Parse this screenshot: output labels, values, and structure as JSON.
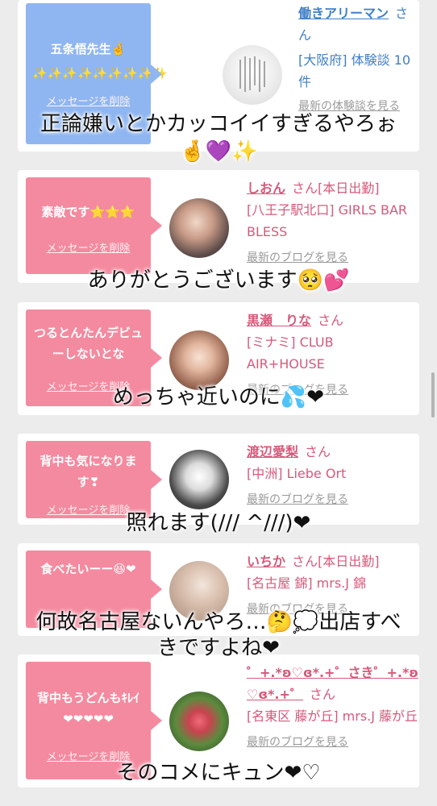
{
  "cards": [
    {
      "message": "五条悟先生🤞\n✨✨✨✨✨✨✨✨✨",
      "delete_label": "メッセージを削除",
      "username": "働きアリーマン",
      "san": "さん",
      "location": "[大阪府] 体験談 10件",
      "more_link": "最新の体験談を見る",
      "style": "blue"
    },
    {
      "message": "素敵です⭐⭐⭐",
      "delete_label": "メッセージを削除",
      "username": "しおん",
      "san": "さん[本日出勤]",
      "location": "[八王子駅北口] GIRLS BAR BLESS",
      "more_link": "最新のブログを見る",
      "style": "pink"
    },
    {
      "message": "つるとんたんデビューしないとな",
      "delete_label": "メッセージを削除",
      "username": "黒瀬　りな",
      "san": "さん",
      "location": "[ミナミ] CLUB AIR+HOUSE",
      "more_link": "最新のブログを見る",
      "style": "pink"
    },
    {
      "message": "背中も気になります❣",
      "delete_label": "メッセージを削除",
      "username": "渡辺愛梨",
      "san": "さん",
      "location": "[中洲] Liebe Ort",
      "more_link": "最新のブログを見る",
      "style": "pink"
    },
    {
      "message": "食べたいーー😆❤",
      "delete_label": "メッセージを削除",
      "username": "いちか",
      "san": "さん[本日出勤]",
      "location": "[名古屋 錦] mrs.J 錦",
      "more_link": "最新のブログを見る",
      "style": "pink"
    },
    {
      "message": "背中もうどんもｷﾚｲ❤❤❤❤❤",
      "delete_label": "メッセージを削除",
      "username": "゜+.*ʚ♡ɞ*.+゜さき゜+.*ʚ♡ɞ*.+゜",
      "san": "さん",
      "location": "[名東区 藤が丘] mrs.J 藤が丘",
      "more_link": "最新のブログを見る",
      "style": "pink"
    }
  ],
  "captions": [
    "正論嫌いとかカッコイイすぎるやろぉ",
    "🤞💜✨",
    "ありがとうございます🥺💕",
    "めっちゃ近いのに💦❤",
    "照れます(/// ^///)❤",
    "何故名古屋ないんやろ…🤔💭出店すべ",
    "きですよね❤",
    "そのコメにキュン❤♡"
  ]
}
